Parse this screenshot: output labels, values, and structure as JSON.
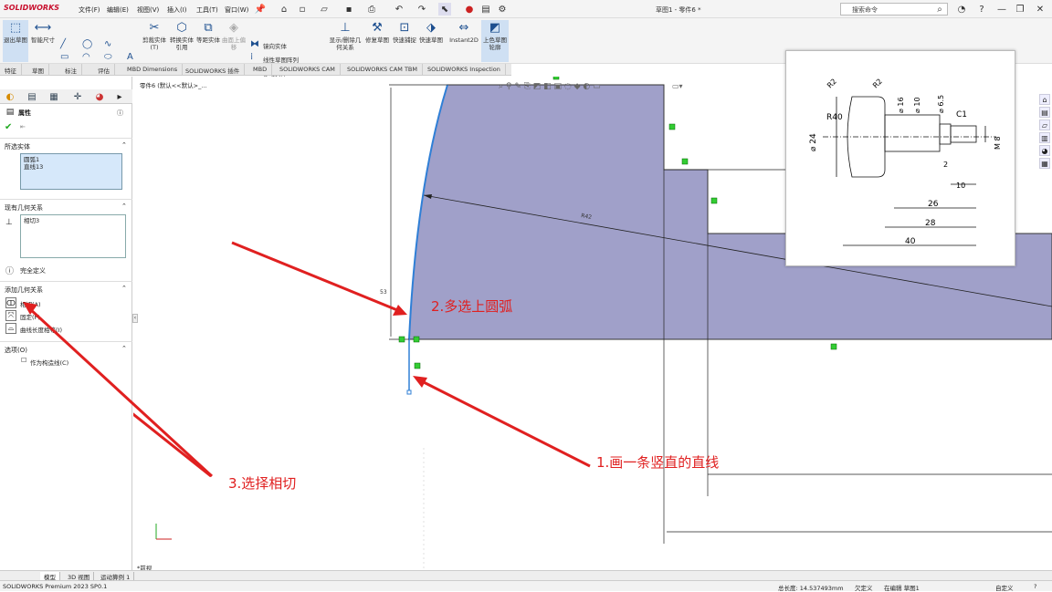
{
  "app": {
    "logo": "SOLIDWORKS",
    "doc_title": "草图1 - 零件6 *",
    "search_placeholder": "搜索命令"
  },
  "menus": [
    "文件(F)",
    "编辑(E)",
    "视图(V)",
    "插入(I)",
    "工具(T)",
    "窗口(W)"
  ],
  "commands": {
    "exit_sketch": "退出草图",
    "smart_dim": "智能尺寸",
    "trim": "剪裁实体(T)",
    "convert": "转换实体引用",
    "offset": "等距实体",
    "surface_offset": "曲面上偏移",
    "mirror": "镜向实体",
    "linear_pattern": "线性草图阵列",
    "move": "移动实体",
    "relations": "显示/删除几何关系",
    "repair": "修复草图",
    "quick_snaps": "快速捕捉",
    "rapid_sketch": "快速草图",
    "instant2d": "Instant2D",
    "shaded_sketch": "上色草图轮廓"
  },
  "tabs": [
    "特征",
    "草图",
    "标注",
    "评估",
    "MBD Dimensions",
    "SOLIDWORKS 插件",
    "MBD",
    "SOLIDWORKS CAM",
    "SOLIDWORKS CAM TBM",
    "SOLIDWORKS Inspection"
  ],
  "active_tab": "草图",
  "feature_tree": {
    "item": "零件6 (默认<<默认>_..."
  },
  "property_manager": {
    "title": "属性",
    "selected_entities_title": "所选实体",
    "selected_entities": [
      "圆弧1",
      "直线13"
    ],
    "existing_relations_title": "现有几何关系",
    "existing_relations": [
      "相切3"
    ],
    "status": "完全定义",
    "add_relations_title": "添加几何关系",
    "add_relations": [
      "相切(A)",
      "固定(F)",
      "曲线长度相等(I)"
    ],
    "options_title": "选项(O)",
    "construction": "作为构造线(C)"
  },
  "graphics": {
    "dim_r": "R42",
    "dim_v": "53",
    "annotations": {
      "step1": "1.画一条竖直的直线",
      "step2": "2.多选上圆弧",
      "step3": "3.选择相切"
    },
    "view_label": "*前视"
  },
  "inset_drawing": {
    "dims": [
      "R2",
      "R2",
      "R40",
      "⌀ 16",
      "⌀ 10",
      "⌀ 6.5",
      "C1",
      "⌀ 24",
      "M 8",
      "2",
      "10",
      "26",
      "28",
      "40"
    ]
  },
  "bottom_tabs": [
    "模型",
    "3D 视图",
    "运动算例 1"
  ],
  "status": {
    "version": "SOLIDWORKS Premium 2023 SP0.1",
    "length": "总长度: 14.537493mm",
    "defined": "欠定义",
    "editing": "在编辑 草图1",
    "custom": "自定义"
  },
  "colors": {
    "body": "#9c9cc7",
    "arrow": "#e02020",
    "sketch_blue": "#2f7fd6"
  }
}
